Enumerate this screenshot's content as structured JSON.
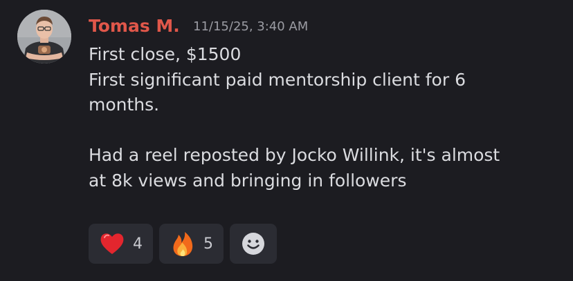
{
  "message": {
    "author": "Tomas M.",
    "timestamp": "11/15/25, 3:40 AM",
    "lines": [
      "First close, $1500",
      "First significant paid mentorship client for 6",
      "months.",
      "",
      "Had a reel reposted by Jocko Willink, it's almost",
      "at 8k views and bringing in followers"
    ],
    "reactions": [
      {
        "emoji_icon": "red-heart-icon",
        "count": "4"
      },
      {
        "emoji_icon": "fire-icon",
        "count": "5"
      }
    ],
    "add_reaction_icon": "smiley-face-icon"
  },
  "colors": {
    "background": "#1c1c21",
    "author": "#e0574a",
    "text": "#dbdce0",
    "timestamp": "#9b9ca3",
    "reaction_bg": "#2b2c33"
  }
}
